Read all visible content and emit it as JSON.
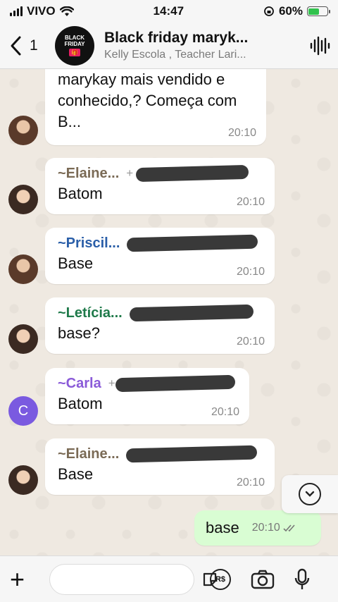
{
  "status": {
    "carrier": "VIVO",
    "time": "14:47",
    "battery": "60%",
    "battery_level": 0.6
  },
  "header": {
    "back_count": "1",
    "title": "Black friday maryk...",
    "subtitle": "Kelly Escola , Teacher Lari...",
    "avatar_text_1": "BLACK",
    "avatar_text_2": "FRIDAY"
  },
  "messages": [
    {
      "text": "marykay mais vendido e conhecido,? Começa com B...",
      "time": "20:10"
    },
    {
      "sender": "~Elaine...",
      "sender_color": "#7a6a55",
      "phone": "+",
      "text": "Batom",
      "time": "20:10"
    },
    {
      "sender": "~Priscil...",
      "sender_color": "#2a5ea8",
      "text": "Base",
      "time": "20:10"
    },
    {
      "sender": "~Letícia...",
      "sender_color": "#1f7a4a",
      "text": "base?",
      "time": "20:10"
    },
    {
      "sender": "~Carla",
      "sender_color": "#8a5ad8",
      "phone": "+",
      "text": "Batom",
      "time": "20:10",
      "avatar_initial": "C"
    },
    {
      "sender": "~Elaine...",
      "sender_color": "#7a6a55",
      "text": "Base",
      "time": "20:10"
    }
  ],
  "outgoing": {
    "text": "base",
    "time": "20:10"
  },
  "input": {
    "placeholder": ""
  },
  "colors": {
    "outgoing_bubble": "#d9fdd3",
    "incoming_bubble": "#ffffff",
    "chat_background": "#efe9e1"
  }
}
